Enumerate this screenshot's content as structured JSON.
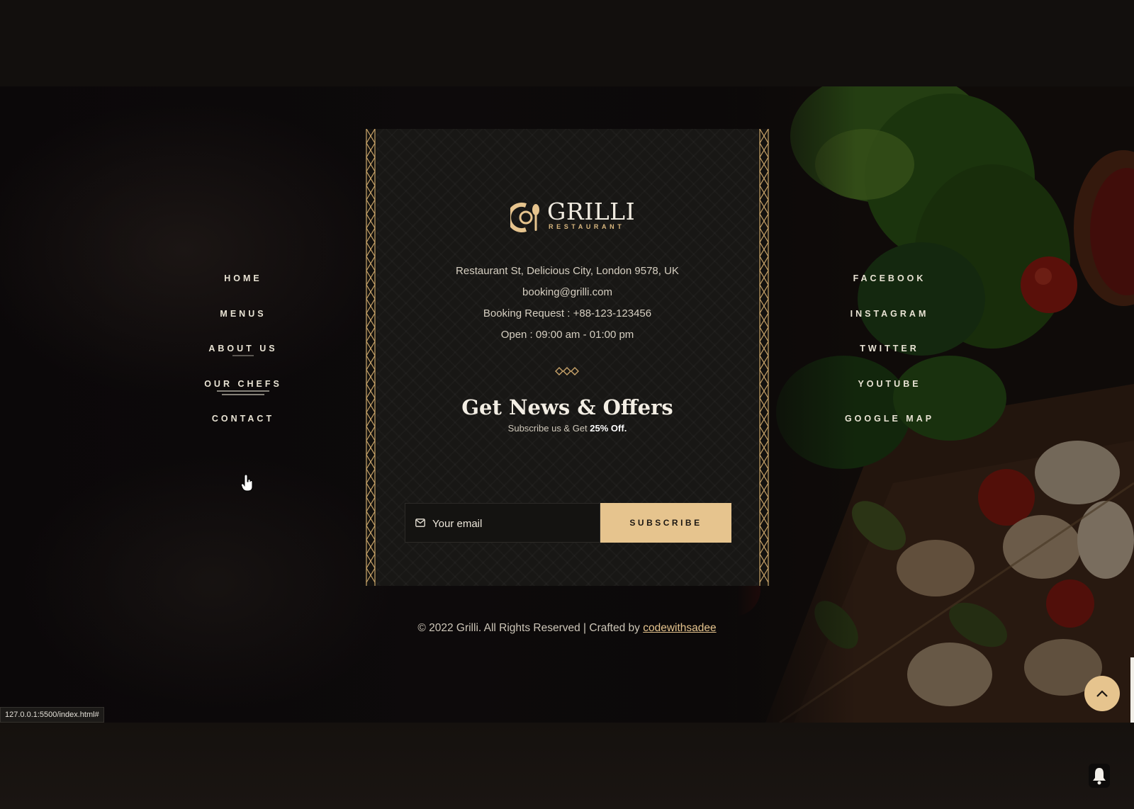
{
  "nav": {
    "items": [
      {
        "label": "HOME"
      },
      {
        "label": "MENUS"
      },
      {
        "label": "ABOUT US"
      },
      {
        "label": "OUR CHEFS"
      },
      {
        "label": "CONTACT"
      }
    ]
  },
  "social": {
    "items": [
      {
        "label": "FACEBOOK"
      },
      {
        "label": "INSTAGRAM"
      },
      {
        "label": "TWITTER"
      },
      {
        "label": "YOUTUBE"
      },
      {
        "label": "GOOGLE MAP"
      }
    ]
  },
  "brand": {
    "name": "GRILLI",
    "tagline": "RESTAURANT"
  },
  "contact": {
    "address": "Restaurant St, Delicious City, London 9578, UK",
    "email": "booking@grilli.com",
    "booking": "Booking Request : +88-123-123456",
    "hours": "Open : 09:00 am - 01:00 pm"
  },
  "newsletter": {
    "title": "Get News & Offers",
    "subtitle_prefix": "Subscribe us & Get ",
    "subtitle_highlight": "25% Off.",
    "email_placeholder": "Your email",
    "button_label": "SUBSCRIBE"
  },
  "footer": {
    "copyright_prefix": "© 2022 Grilli. All Rights Reserved | Crafted by ",
    "credit_link": "codewithsadee"
  },
  "status_bar": {
    "url": "127.0.0.1:5500/index.html#"
  },
  "icons": {
    "mail": "mail-icon",
    "back_to_top": "chevron-up-icon",
    "notification": "bell-icon",
    "cursor": "hand-pointer-icon"
  },
  "colors": {
    "accent": "#e6c48e",
    "background": "#0c0909",
    "card": "#181715"
  }
}
